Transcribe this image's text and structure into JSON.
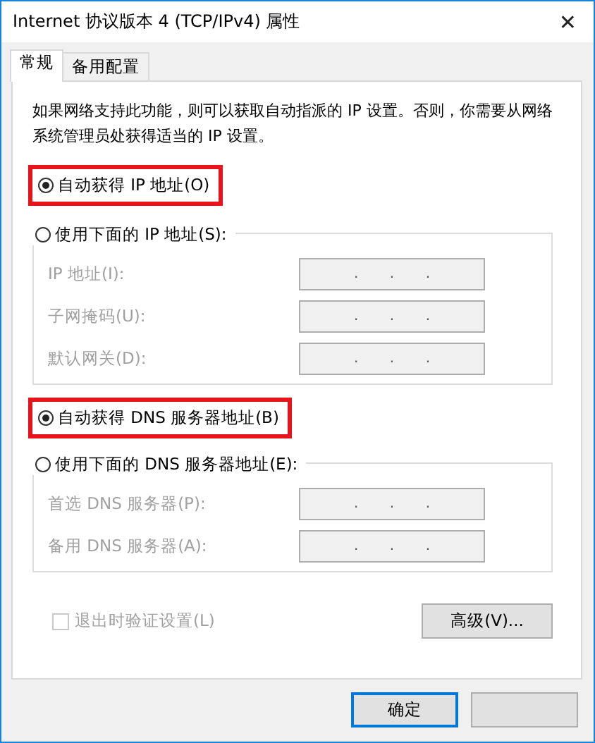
{
  "window": {
    "title": "Internet 协议版本 4 (TCP/IPv4) 属性",
    "close": "✕"
  },
  "tabs": [
    {
      "label": "常规",
      "selected": true
    },
    {
      "label": "备用配置",
      "selected": false
    }
  ],
  "description": "如果网络支持此功能，则可以获取自动指派的 IP 设置。否则，你需要从网络系统管理员处获得适当的 IP 设置。",
  "sections": [
    {
      "auto": {
        "label": "自动获得 IP 地址(O)",
        "selected": true,
        "highlighted": true
      },
      "manual": {
        "label": "使用下面的 IP 地址(S):",
        "selected": false
      },
      "fields": [
        {
          "label": "IP 地址(I):",
          "value": ".       .       .",
          "disabled": true
        },
        {
          "label": "子网掩码(U):",
          "value": ".       .       .",
          "disabled": true
        },
        {
          "label": "默认网关(D):",
          "value": ".       .       .",
          "disabled": true
        }
      ]
    },
    {
      "auto": {
        "label": "自动获得 DNS 服务器地址(B)",
        "selected": true,
        "highlighted": true
      },
      "manual": {
        "label": "使用下面的 DNS 服务器地址(E):",
        "selected": false
      },
      "fields": [
        {
          "label": "首选 DNS 服务器(P):",
          "value": ".       .       .",
          "disabled": true
        },
        {
          "label": "备用 DNS 服务器(A):",
          "value": ".       .       .",
          "disabled": true
        }
      ]
    }
  ],
  "validate": {
    "label": "退出时验证设置(L)",
    "checked": false,
    "disabled": true
  },
  "advanced_button": "高级(V)...",
  "ok_button": "确定"
}
